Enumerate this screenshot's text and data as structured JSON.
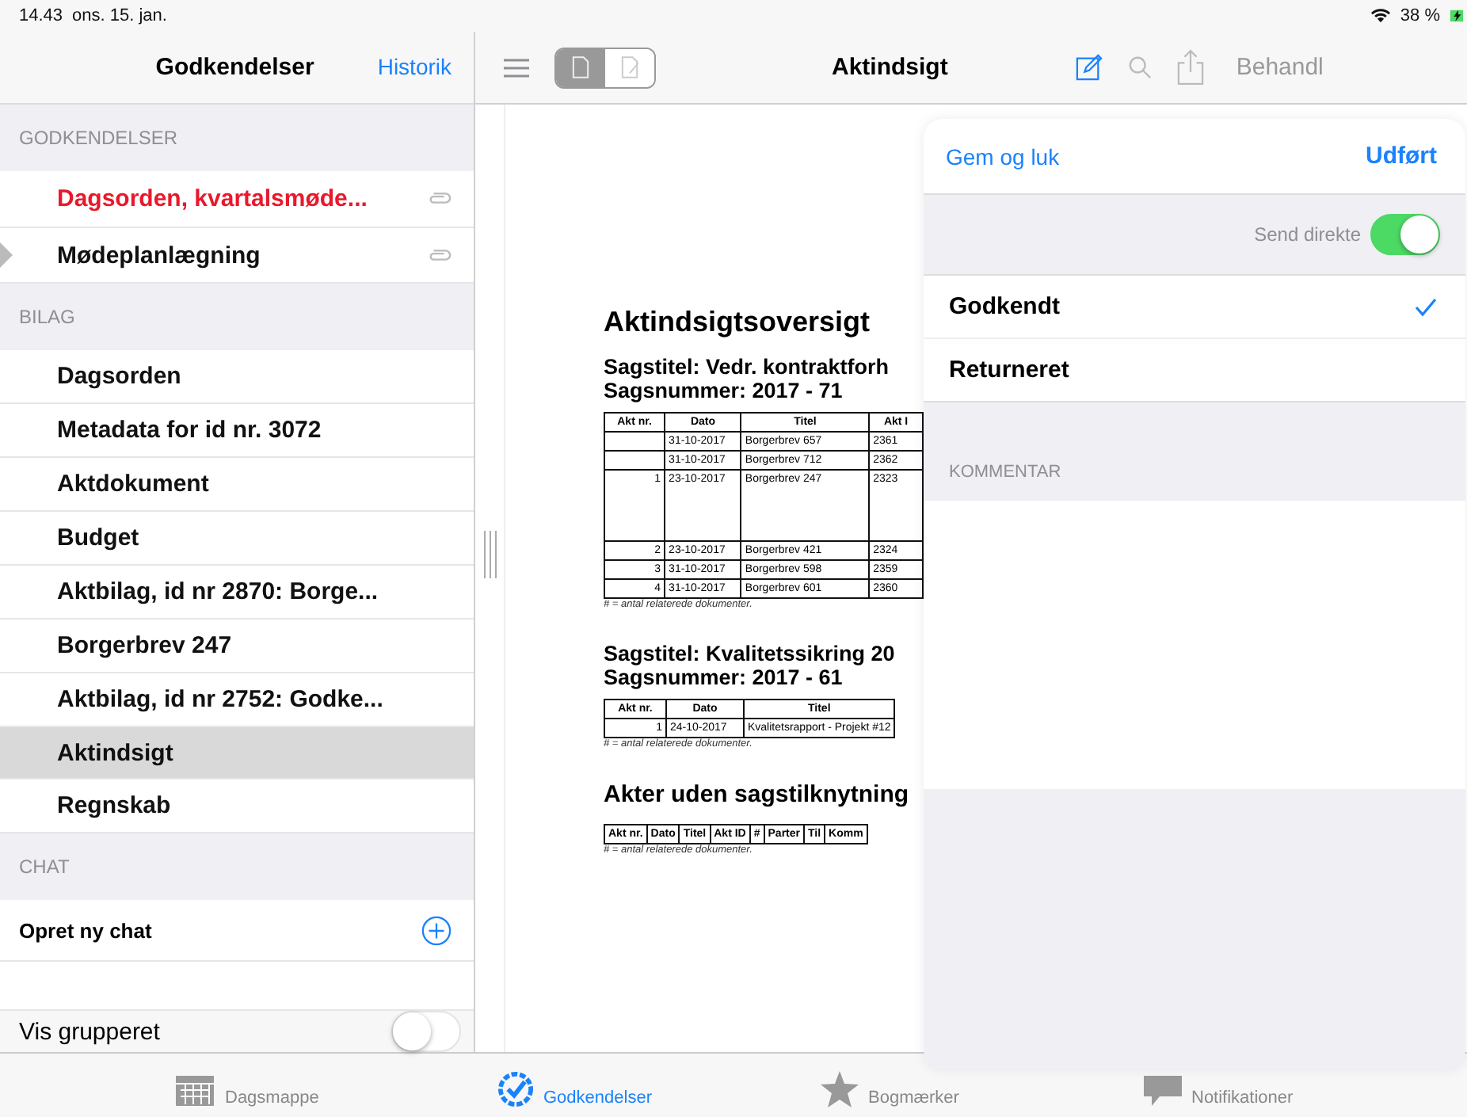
{
  "status_bar": {
    "time": "14.43",
    "date": "ons. 15. jan.",
    "battery": "38 %"
  },
  "sidebar": {
    "title": "Godkendelser",
    "history_link": "Historik",
    "sections": [
      {
        "header": "GODKENDELSER",
        "items": [
          {
            "label": "Dagsorden, kvartalsmøde...",
            "highlighted": true,
            "marker": false,
            "attachment": true,
            "selected": false
          },
          {
            "label": "Mødeplanlægning",
            "highlighted": false,
            "marker": true,
            "attachment": true,
            "selected": false
          }
        ]
      },
      {
        "header": "BILAG",
        "items": [
          {
            "label": "Dagsorden",
            "highlighted": false,
            "selected": false
          },
          {
            "label": "Metadata for id nr. 3072",
            "highlighted": false,
            "selected": false
          },
          {
            "label": "Aktdokument",
            "highlighted": false,
            "selected": false
          },
          {
            "label": "Budget",
            "highlighted": false,
            "selected": false
          },
          {
            "label": "Aktbilag, id nr 2870: Borge...",
            "highlighted": false,
            "selected": false
          },
          {
            "label": "Borgerbrev 247",
            "highlighted": false,
            "selected": false
          },
          {
            "label": "Aktbilag, id nr 2752: Godke...",
            "highlighted": false,
            "selected": false
          },
          {
            "label": "Aktindsigt",
            "highlighted": false,
            "selected": true
          },
          {
            "label": "Regnskab",
            "highlighted": false,
            "selected": false
          }
        ]
      }
    ],
    "chat": {
      "header": "CHAT",
      "new_chat": "Opret ny chat"
    },
    "grouping": {
      "label": "Vis grupperet",
      "on": false
    }
  },
  "toolbar": {
    "view_modes": [
      {
        "selected": true
      },
      {
        "selected": false
      }
    ],
    "title": "Aktindsigt",
    "action": "Behandl"
  },
  "document": {
    "heading": "Aktindsigtsoversigt",
    "cases": [
      {
        "title": "Sagstitel: Vedr. kontraktforh",
        "number": "Sagsnummer: 2017 - 71",
        "columns": [
          "Akt nr.",
          "Dato",
          "Titel",
          "Akt I"
        ],
        "rows": [
          [
            "",
            "31-10-2017",
            "Borgerbrev 657",
            "2361"
          ],
          [
            "",
            "31-10-2017",
            "Borgerbrev 712",
            "2362"
          ],
          [
            "1",
            "23-10-2017",
            "Borgerbrev 247",
            "2323"
          ],
          [
            "2",
            "23-10-2017",
            "Borgerbrev 421",
            "2324"
          ],
          [
            "3",
            "31-10-2017",
            "Borgerbrev 598",
            "2359"
          ],
          [
            "4",
            "31-10-2017",
            "Borgerbrev 601",
            "2360"
          ]
        ],
        "footnote": "# = antal relaterede dokumenter."
      },
      {
        "title": "Sagstitel: Kvalitetssikring 20",
        "number": "Sagsnummer: 2017 - 61",
        "columns": [
          "Akt nr.",
          "Dato",
          "Titel"
        ],
        "rows": [
          [
            "1",
            "24-10-2017",
            "Kvalitetsrapport - Projekt #12"
          ]
        ],
        "footnote": "# = antal relaterede dokumenter."
      }
    ],
    "unrelated": {
      "title": "Akter uden sagstilknytning",
      "columns": [
        "Akt nr.",
        "Dato",
        "Titel",
        "Akt ID",
        "#",
        "Parter",
        "Til",
        "Komm"
      ],
      "footnote": "# = antal relaterede dokumenter."
    }
  },
  "popover": {
    "save": "Gem og luk",
    "done": "Udført",
    "send_direct": {
      "label": "Send direkte",
      "on": true
    },
    "options": [
      {
        "label": "Godkendt",
        "selected": true
      },
      {
        "label": "Returneret",
        "selected": false
      }
    ],
    "comment_header": "KOMMENTAR"
  },
  "tabs": [
    {
      "label": "Dagsmappe",
      "kind": "calendar",
      "selected": false
    },
    {
      "label": "Godkendelser",
      "kind": "badge",
      "selected": true
    },
    {
      "label": "Bogmærker",
      "kind": "star",
      "selected": false
    },
    {
      "label": "Notifikationer",
      "kind": "speech",
      "selected": false
    }
  ]
}
